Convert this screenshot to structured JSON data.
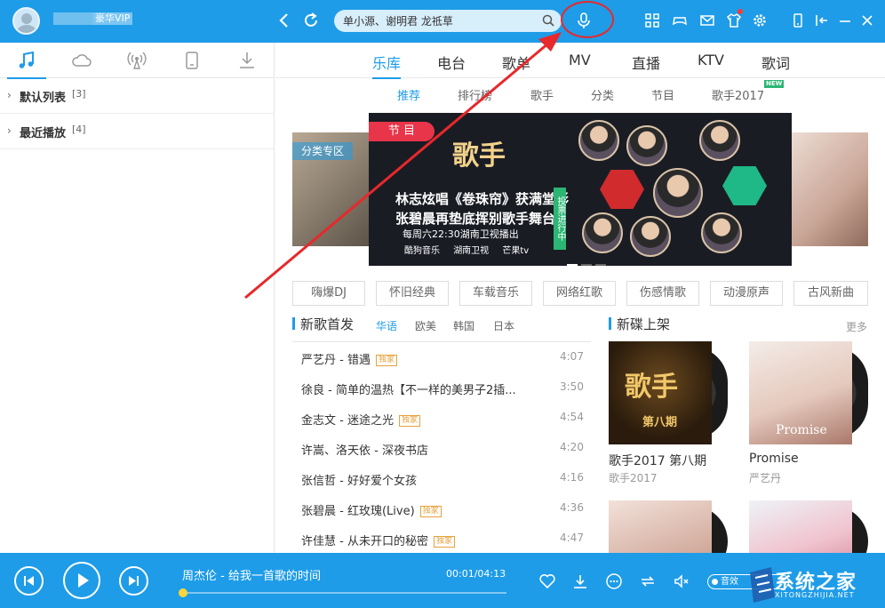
{
  "header": {
    "vip_label": "豪华VIP",
    "search_placeholder": "单小源、谢明君 龙祗草"
  },
  "sidebar": {
    "playlists": [
      {
        "name": "默认列表",
        "count": "[3]"
      },
      {
        "name": "最近播放",
        "count": "[4]"
      }
    ]
  },
  "main_tabs": [
    "乐库",
    "电台",
    "歌单",
    "MV",
    "直播",
    "KTV",
    "歌词"
  ],
  "sub_tabs": [
    "推荐",
    "排行榜",
    "歌手",
    "分类",
    "节目",
    "歌手2017"
  ],
  "new_badge": "NEW",
  "banner": {
    "category_tag": "分类专区",
    "label": "节 目",
    "logo": "歌手",
    "line1": "林志炫唱《卷珠帘》获满堂彩",
    "line2": "张碧晨再垫底挥别歌手舞台",
    "line3": "每周六22:30湖南卫视播出",
    "vote": "投票进行中",
    "partners": [
      "酷狗音乐",
      "湖南卫视",
      "芒果tv"
    ]
  },
  "genre_tags": [
    "嗨爆DJ",
    "怀旧经典",
    "车载音乐",
    "网络红歌",
    "伤感情歌",
    "动漫原声",
    "古风新曲"
  ],
  "new_songs": {
    "title": "新歌首发",
    "filters": [
      "华语",
      "欧美",
      "韩国",
      "日本"
    ],
    "songs": [
      {
        "title": "严艺丹 - 错遇",
        "dj": "独家",
        "duration": "4:07"
      },
      {
        "title": "徐良 - 简单的温热【不一样的美男子2插...",
        "dj": "",
        "duration": "3:50"
      },
      {
        "title": "金志文 - 迷途之光",
        "dj": "独家",
        "duration": "4:54"
      },
      {
        "title": "许嵩、洛天依 - 深夜书店",
        "dj": "",
        "duration": "4:20"
      },
      {
        "title": "张信哲 - 好好爱个女孩",
        "dj": "",
        "duration": "4:16"
      },
      {
        "title": "张碧晨 - 红玫瑰(Live)",
        "dj": "独家",
        "duration": "4:36"
      },
      {
        "title": "许佳慧 - 从未开口的秘密",
        "dj": "独家",
        "duration": "4:47"
      }
    ]
  },
  "new_albums": {
    "title": "新碟上架",
    "more": "更多",
    "albums": [
      {
        "name": "歌手2017 第八期",
        "artist": "歌手2017",
        "cover_text": "第八期"
      },
      {
        "name": "Promise",
        "artist": "严艺丹",
        "cover_text": "Promise"
      }
    ]
  },
  "player": {
    "now_playing": "周杰伦 - 给我一首歌的时间",
    "time": "00:01/04:13",
    "progress": 0.004,
    "sound_label": "音效"
  },
  "watermark": {
    "text": "系统之家",
    "sub": "XITONGZHIJIA.NET"
  },
  "colors": {
    "accent": "#1e9ce8",
    "annotation": "#e8282b"
  }
}
